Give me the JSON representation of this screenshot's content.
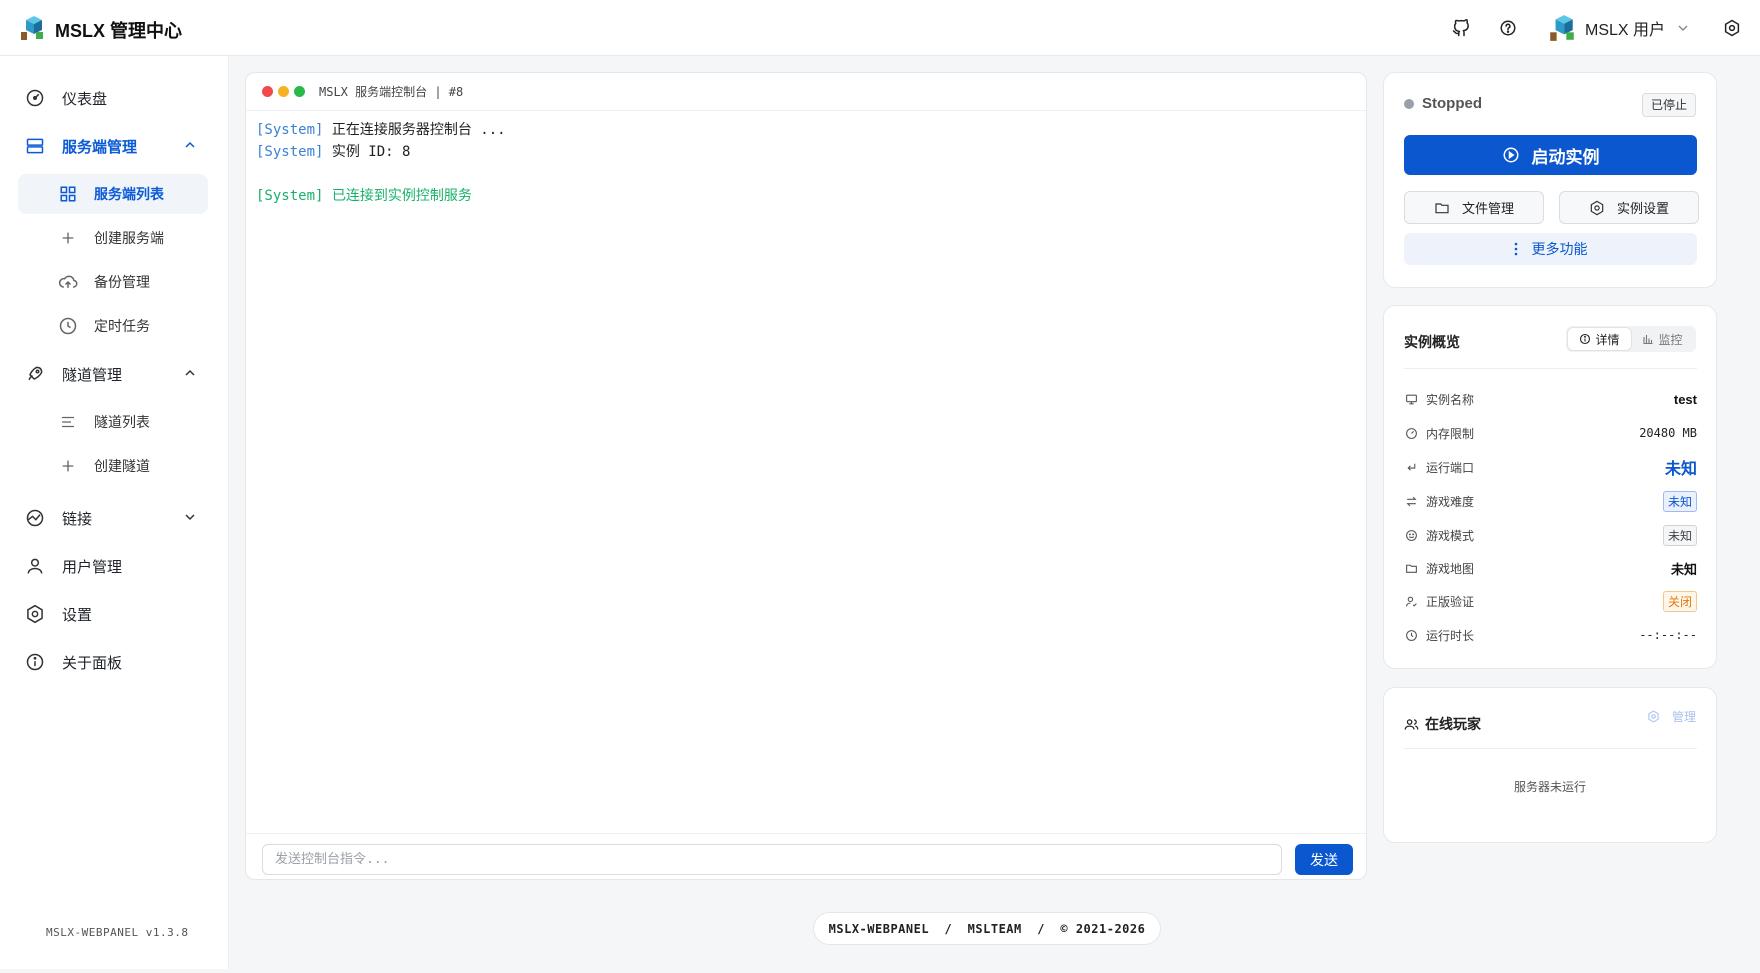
{
  "app": {
    "title": "MSLX 管理中心",
    "version": "MSLX-WEBPANEL v1.3.8"
  },
  "header": {
    "user_name": "MSLX 用户"
  },
  "sidebar": {
    "dashboard": "仪表盘",
    "server_mgmt": "服务端管理",
    "server_list": "服务端列表",
    "create_server": "创建服务端",
    "backup": "备份管理",
    "scheduled": "定时任务",
    "tunnel_mgmt": "隧道管理",
    "tunnel_list": "隧道列表",
    "create_tunnel": "创建隧道",
    "links": "链接",
    "users": "用户管理",
    "settings": "设置",
    "about": "关于面板"
  },
  "console": {
    "title": "MSLX 服务端控制台 | #8",
    "lines": [
      {
        "tag": "[System]",
        "text": " 正在连接服务器控制台 ..."
      },
      {
        "tag": "[System]",
        "text": " 实例 ID: 8"
      },
      {
        "tag": "",
        "text": ""
      },
      {
        "tag": "[System]",
        "text": " 已连接到实例控制服务"
      }
    ],
    "input_placeholder": "发送控制台指令...",
    "send_label": "发送"
  },
  "control": {
    "status": "Stopped",
    "status_badge": "已停止",
    "start_label": "启动实例",
    "files_label": "文件管理",
    "instance_settings_label": "实例设置",
    "more_label": "更多功能"
  },
  "overview": {
    "title": "实例概览",
    "tab_details": "详情",
    "tab_monitor": "监控",
    "rows": {
      "name_key": "实例名称",
      "name_val": "test",
      "memory_key": "内存限制",
      "memory_val": "20480 MB",
      "port_key": "运行端口",
      "port_val": "未知",
      "difficulty_key": "游戏难度",
      "difficulty_val": "未知",
      "mode_key": "游戏模式",
      "mode_val": "未知",
      "map_key": "游戏地图",
      "map_val": "未知",
      "auth_key": "正版验证",
      "auth_val": "关闭",
      "uptime_key": "运行时长",
      "uptime_val": "--:--:--"
    }
  },
  "players": {
    "title": "在线玩家",
    "manage_label": "管理",
    "empty": "服务器未运行"
  },
  "footer": {
    "text": "MSLX-WEBPANEL  /  MSLTEAM  /  © 2021-2026"
  },
  "colors": {
    "accent": "#0b57d0",
    "status_stopped": "#9aa0a8",
    "log_tag": "#3b82d6",
    "log_ok": "#18b16b"
  }
}
